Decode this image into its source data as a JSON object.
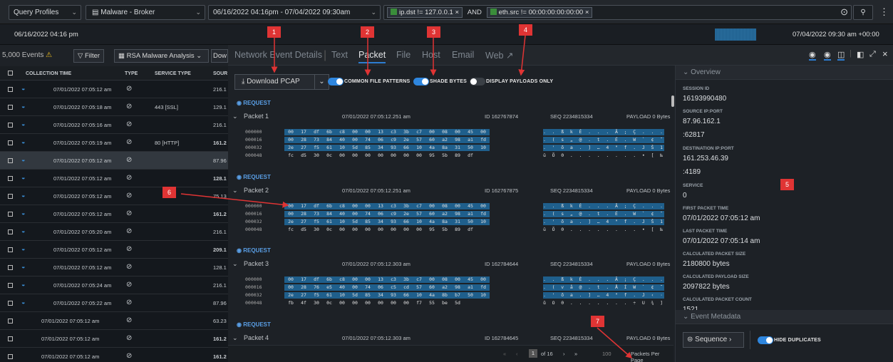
{
  "topbar": {
    "profile": "Query Profiles",
    "service": "Malware - Broker",
    "time_range": "06/16/2022 04:16pm  -  07/04/2022 09:30am",
    "filter1": "ip.dst != 127.0.0.1",
    "and_label": "AND",
    "filter2": "eth.src != 00:00:00:00:00:00"
  },
  "timeline": {
    "start": "06/16/2022 04:16 pm",
    "end": "07/04/2022 09:30 am +00:00"
  },
  "events": {
    "count_label": "5,000 Events",
    "filter_button": "Filter",
    "profile_select": "RSA Malware Analysis",
    "download_short": "Dow"
  },
  "table": {
    "headers": [
      "COLLECTION TIME",
      "TYPE",
      "SERVICE TYPE",
      "SOUR"
    ],
    "rows": [
      {
        "time": "07/01/2022 07:05:12 am",
        "service": "",
        "source": "216.1"
      },
      {
        "time": "07/01/2022 07:05:18 am",
        "service": "443 [SSL]",
        "source": "129.1"
      },
      {
        "time": "07/01/2022 07:05:16 am",
        "service": "",
        "source": "216.1"
      },
      {
        "time": "07/01/2022 07:05:19 am",
        "service": "80 [HTTP]",
        "source": "161.2"
      },
      {
        "time": "07/01/2022 07:05:12 am",
        "service": "",
        "source": "87.96"
      },
      {
        "time": "07/01/2022 07:05:12 am",
        "service": "",
        "source": "128.1"
      },
      {
        "time": "07/01/2022 07:05:12 am",
        "service": "",
        "source": "75.13"
      },
      {
        "time": "07/01/2022 07:05:12 am",
        "service": "",
        "source": "161.2"
      },
      {
        "time": "07/01/2022 07:05:20 am",
        "service": "",
        "source": "216.1"
      },
      {
        "time": "07/01/2022 07:05:12 am",
        "service": "",
        "source": "209.1"
      },
      {
        "time": "07/01/2022 07:05:12 am",
        "service": "",
        "source": "128.1"
      },
      {
        "time": "07/01/2022 07:05:24 am",
        "service": "",
        "source": "216.1"
      },
      {
        "time": "07/01/2022 07:05:22 am",
        "service": "",
        "source": "87.96"
      },
      {
        "time": "07/01/2022 07:05:12 am",
        "service": "",
        "source": "63.23"
      },
      {
        "time": "07/01/2022 07:05:12 am",
        "service": "",
        "source": "161.2"
      },
      {
        "time": "07/01/2022 07:05:12 am",
        "service": "",
        "source": "161.2"
      }
    ]
  },
  "panel": {
    "tabs": [
      "Network Event Details",
      "Text",
      "Packet",
      "File",
      "Host",
      "Email",
      "Web"
    ],
    "download_pcap": "Download PCAP",
    "toggle_common": "COMMON FILE PATTERNS",
    "toggle_shade": "SHADE BYTES",
    "toggle_payload": "DISPLAY PAYLOADS ONLY",
    "request_label": "REQUEST",
    "packets": [
      {
        "name": "Packet 1",
        "time": "07/01/2022 07:05:12.251 am",
        "id": "ID 162767874",
        "seq": "SEQ 2234815334",
        "payload": "PAYLOAD 0 Bytes"
      },
      {
        "name": "Packet 2",
        "time": "07/01/2022 07:05:12.251 am",
        "id": "ID 162767875",
        "seq": "SEQ 2234815334",
        "payload": "PAYLOAD 0 Bytes"
      },
      {
        "name": "Packet 3",
        "time": "07/01/2022 07:05:12.303 am",
        "id": "ID 162784644",
        "seq": "SEQ 2234815334",
        "payload": "PAYLOAD 0 Bytes"
      },
      {
        "name": "Packet 4",
        "time": "07/01/2022 07:05:12.303 am",
        "id": "ID 162784645",
        "seq": "SEQ 2234815334",
        "payload": "PAYLOAD 0 Bytes"
      }
    ],
    "hex": [
      {
        "rows": [
          {
            "off": "000000",
            "b": [
              "00",
              "17",
              "df",
              "6b",
              "c8",
              "00",
              "00",
              "13",
              "c3",
              "3b",
              "c7",
              "00",
              "08",
              "00",
              "45",
              "00"
            ],
            "a": ". . ß k È . . . Ã ; Ç . . . E ."
          },
          {
            "off": "000016",
            "b": [
              "00",
              "28",
              "73",
              "84",
              "40",
              "00",
              "74",
              "06",
              "c9",
              "2e",
              "57",
              "60",
              "a2",
              "98",
              "a1",
              "fd"
            ],
            "a": ". ( s „ @ . t . É . W ` ¢ ˜ ¡ ý"
          },
          {
            "off": "000032",
            "b": [
              "2e",
              "27",
              "f5",
              "61",
              "10",
              "5d",
              "85",
              "34",
              "93",
              "66",
              "10",
              "4a",
              "8a",
              "31",
              "50",
              "10"
            ],
            "a": ". ' õ a . ] … 4 \" f . J Š 1 P ."
          },
          {
            "off": "000048",
            "b": [
              "fc",
              "d5",
              "30",
              "0c",
              "00",
              "00",
              "00",
              "00",
              "00",
              "00",
              "00",
              "95",
              "5b",
              "89",
              "df"
            ],
            "a": "ü Õ 0 . . . . . . . . • [ ‰ ß"
          }
        ]
      },
      {
        "rows": [
          {
            "off": "000000",
            "b": [
              "00",
              "17",
              "df",
              "6b",
              "c8",
              "00",
              "00",
              "13",
              "c3",
              "3b",
              "c7",
              "00",
              "08",
              "00",
              "45",
              "00"
            ],
            "a": ". . ß k È . . . Ã ; Ç . . . E ."
          },
          {
            "off": "000016",
            "b": [
              "00",
              "28",
              "73",
              "84",
              "40",
              "00",
              "74",
              "06",
              "c9",
              "2e",
              "57",
              "60",
              "a2",
              "98",
              "a1",
              "fd"
            ],
            "a": ". ( s „ @ . t . É . W ` ¢ ˜ ¡ ý"
          },
          {
            "off": "000032",
            "b": [
              "2e",
              "27",
              "f5",
              "61",
              "10",
              "5d",
              "85",
              "34",
              "93",
              "66",
              "10",
              "4a",
              "8a",
              "31",
              "50",
              "10"
            ],
            "a": ". ' õ a . ] … 4 \" f . J Š 1 P ."
          },
          {
            "off": "000048",
            "b": [
              "fc",
              "d5",
              "30",
              "0c",
              "00",
              "00",
              "00",
              "00",
              "00",
              "00",
              "00",
              "95",
              "5b",
              "89",
              "df"
            ],
            "a": "ü Õ 0 . . . . . . . . • [ ‰ ß"
          }
        ]
      },
      {
        "rows": [
          {
            "off": "000000",
            "b": [
              "00",
              "17",
              "df",
              "6b",
              "c8",
              "00",
              "00",
              "13",
              "c3",
              "3b",
              "c7",
              "00",
              "08",
              "00",
              "45",
              "00"
            ],
            "a": ". . ß k È . . . Ã ; Ç . . . E ."
          },
          {
            "off": "000016",
            "b": [
              "00",
              "28",
              "76",
              "e5",
              "40",
              "00",
              "74",
              "06",
              "c5",
              "cd",
              "57",
              "60",
              "a2",
              "98",
              "a1",
              "fd"
            ],
            "a": ". ( v å @ . t . Å Í W ` ¢ ˜ ¡ ý"
          },
          {
            "off": "000032",
            "b": [
              "2e",
              "27",
              "f5",
              "61",
              "10",
              "5d",
              "85",
              "34",
              "93",
              "66",
              "10",
              "4a",
              "8b",
              "b7",
              "50",
              "10"
            ],
            "a": ". ' õ a . ] … 4 \" f . J ‹ · P ."
          },
          {
            "off": "000048",
            "b": [
              "fb",
              "4f",
              "30",
              "0c",
              "00",
              "00",
              "00",
              "00",
              "00",
              "00",
              "f7",
              "55",
              "be",
              "5d"
            ],
            "a": "û O 0 . . . . . . . ÷ U ¾ ]"
          }
        ]
      }
    ],
    "pager": {
      "page": "1",
      "of": "of 16",
      "per_page_value": "100",
      "per_page_label": "Packets Per Page"
    }
  },
  "overview": {
    "title": "Overview",
    "fields": [
      {
        "label": "SESSION ID",
        "value": "16193990480"
      },
      {
        "label": "SOURCE IP:PORT",
        "value": "87.96.162.1",
        "value2": ":62817"
      },
      {
        "label": "DESTINATION IP:PORT",
        "value": "161.253.46.39",
        "value2": ":4189"
      },
      {
        "label": "SERVICE",
        "value": "0"
      },
      {
        "label": "FIRST PACKET TIME",
        "value": "07/01/2022 07:05:12 am"
      },
      {
        "label": "LAST PACKET TIME",
        "value": "07/01/2022 07:05:14 am"
      },
      {
        "label": "CALCULATED PACKET SIZE",
        "value": "2180800 bytes"
      },
      {
        "label": "CALCULATED PAYLOAD SIZE",
        "value": "2097822 bytes"
      },
      {
        "label": "CALCULATED PACKET COUNT",
        "value": "1521"
      }
    ],
    "event_metadata": "Event Metadata",
    "sequence": "Sequence",
    "hide_duplicates": "HIDE DUPLICATES"
  },
  "annotations": [
    "1",
    "2",
    "3",
    "4",
    "5",
    "6",
    "7"
  ],
  "colors": {
    "accent": "#2d7dd2",
    "annotation": "#e03434",
    "highlight": "#1f5f8c"
  }
}
